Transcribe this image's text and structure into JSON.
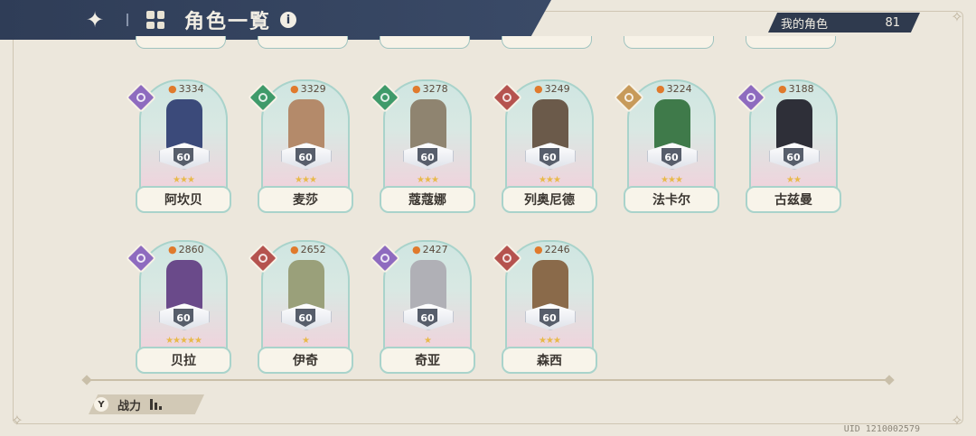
{
  "header": {
    "title": "角色一覧",
    "my_characters_label": "我的角色",
    "my_characters_count": "81"
  },
  "characters": [
    {
      "name": "阿坎贝",
      "power": "3334",
      "level": "60",
      "stars": "★★★",
      "class_color": "#8e6bbf",
      "sprite_color": "#3b4a7a"
    },
    {
      "name": "麦莎",
      "power": "3329",
      "level": "60",
      "stars": "★★★",
      "class_color": "#3f9a6a",
      "sprite_color": "#b48a6a"
    },
    {
      "name": "蔻蔻娜",
      "power": "3278",
      "level": "60",
      "stars": "★★★",
      "class_color": "#3f9a6a",
      "sprite_color": "#8f8470"
    },
    {
      "name": "列奥尼德",
      "power": "3249",
      "level": "60",
      "stars": "★★★",
      "class_color": "#b5534f",
      "sprite_color": "#6b5a4a"
    },
    {
      "name": "法卡尔",
      "power": "3224",
      "level": "60",
      "stars": "★★★",
      "class_color": "#c79a5a",
      "sprite_color": "#3f7a4a"
    },
    {
      "name": "古兹曼",
      "power": "3188",
      "level": "60",
      "stars": "★★",
      "class_color": "#8e6bbf",
      "sprite_color": "#2e2f38"
    },
    {
      "name": "贝拉",
      "power": "2860",
      "level": "60",
      "stars": "★★★★★",
      "class_color": "#8e6bbf",
      "sprite_color": "#6a4a8a"
    },
    {
      "name": "伊奇",
      "power": "2652",
      "level": "60",
      "stars": "★",
      "class_color": "#b5534f",
      "sprite_color": "#9aa07a"
    },
    {
      "name": "奇亚",
      "power": "2427",
      "level": "60",
      "stars": "★",
      "class_color": "#8e6bbf",
      "sprite_color": "#b0b0b6"
    },
    {
      "name": "森西",
      "power": "2246",
      "level": "60",
      "stars": "★★★",
      "class_color": "#b5534f",
      "sprite_color": "#8a6a4a"
    }
  ],
  "footer": {
    "sort_label": "战力",
    "filter_icon_glyph": "Y",
    "uid": "UID 1210002579"
  },
  "icons": [
    "back-icon",
    "grid-icon",
    "info-icon",
    "flame-icon",
    "class-badge-icon",
    "filter-icon",
    "sort-bars-icon"
  ]
}
